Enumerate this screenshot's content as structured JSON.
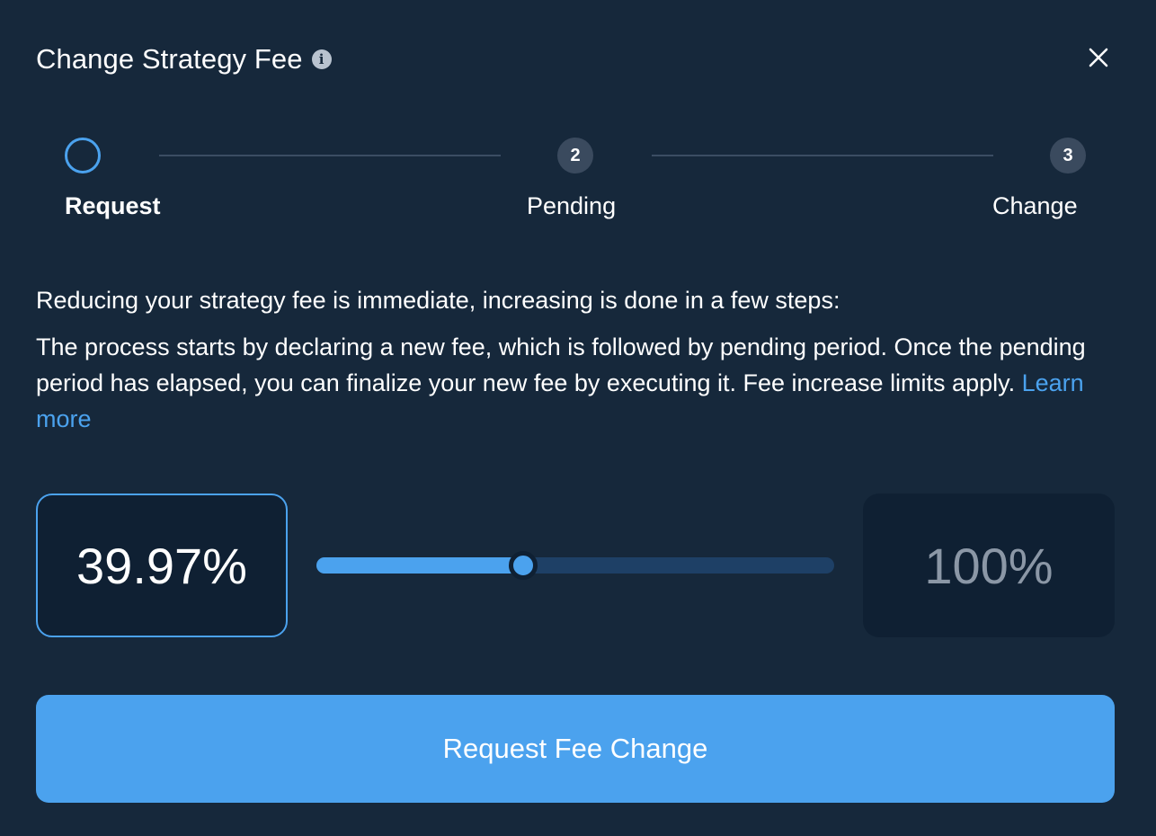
{
  "modal": {
    "title": "Change Strategy Fee",
    "info_icon": "i"
  },
  "stepper": {
    "steps": [
      {
        "number": "",
        "label": "Request",
        "state": "active"
      },
      {
        "number": "2",
        "label": "Pending",
        "state": "inactive"
      },
      {
        "number": "3",
        "label": "Change",
        "state": "inactive"
      }
    ]
  },
  "content": {
    "intro": "Reducing your strategy fee is immediate, increasing is done in a few steps:",
    "description": "The process starts by declaring a new fee, which is followed by pending period. Once the pending period has elapsed, you can finalize your new fee by executing it. Fee increase limits apply.",
    "learn_more": "Learn more"
  },
  "fee": {
    "current_value": "39.97%",
    "max_value": "100%",
    "slider_fraction": 0.3997
  },
  "actions": {
    "request_button": "Request Fee Change"
  },
  "colors": {
    "background": "#16283b",
    "accent": "#4ba2ee",
    "box_background": "#0f2033",
    "muted_text": "#8b97a6"
  }
}
